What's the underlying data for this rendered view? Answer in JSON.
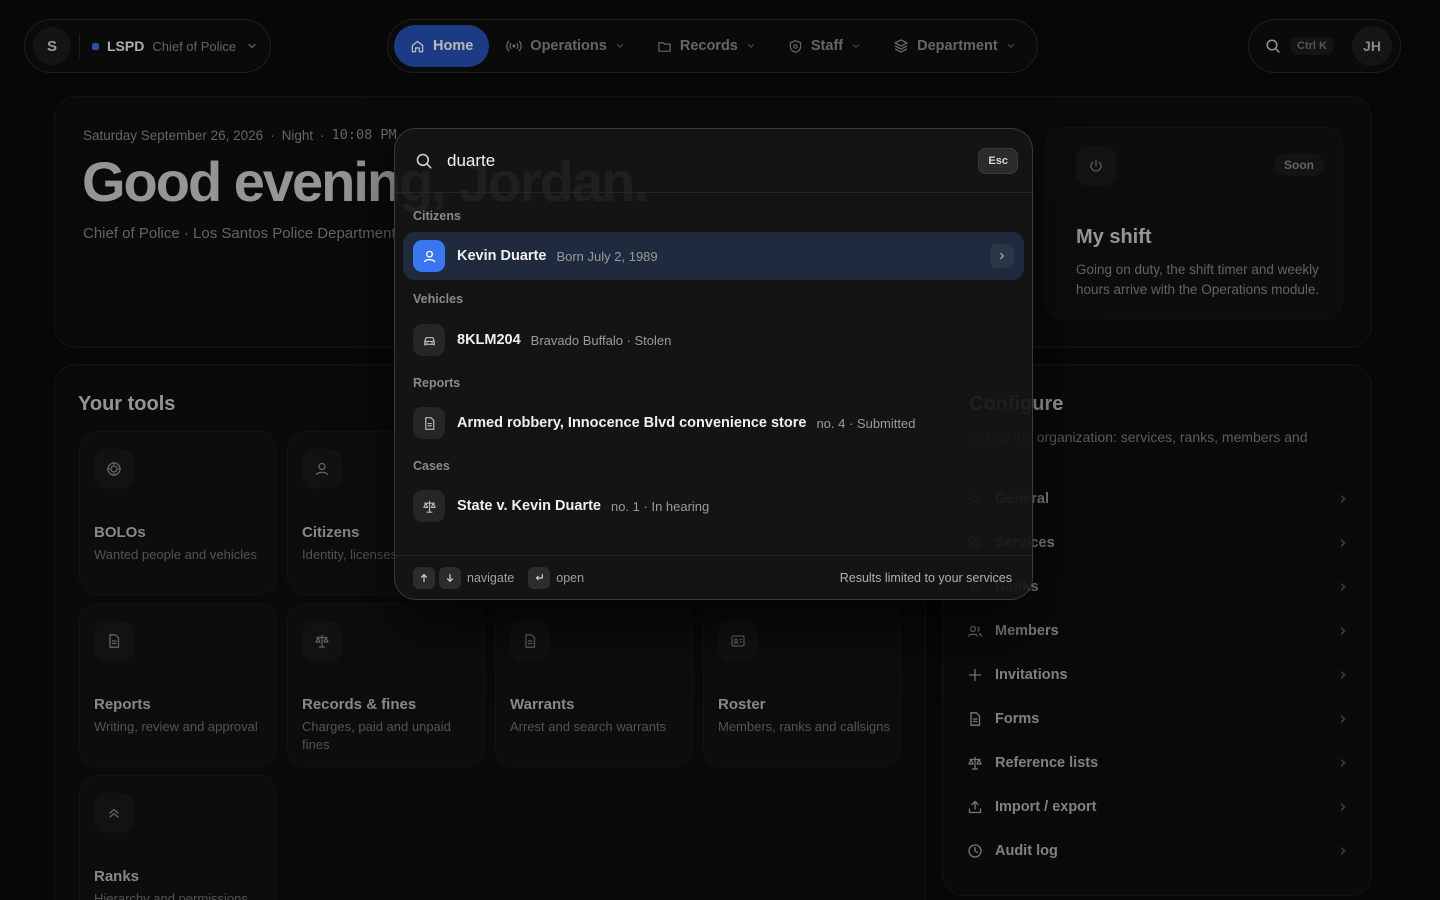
{
  "org": {
    "avatar_letter": "S",
    "name": "LSPD",
    "role": "Chief of Police",
    "accent": "#3b6fe0"
  },
  "nav": {
    "items": [
      {
        "label": "Home",
        "icon": "home-icon",
        "active": true
      },
      {
        "label": "Operations",
        "icon": "radio-icon"
      },
      {
        "label": "Records",
        "icon": "folder-icon"
      },
      {
        "label": "Staff",
        "icon": "badge-icon"
      },
      {
        "label": "Department",
        "icon": "layers-icon"
      }
    ],
    "active_color": "#2753b8"
  },
  "topright": {
    "shortcut": "Ctrl K",
    "user_initials": "JH"
  },
  "hero": {
    "date": "Saturday September 26, 2026",
    "period": "Night",
    "time": "10:08 PM",
    "greeting": "Good evening, Jordan.",
    "subtitle": "Chief of Police · Los Santos Police Department"
  },
  "shift": {
    "badge": "Soon",
    "title": "My shift",
    "description": "Going on duty, the shift timer and weekly hours arrive with the Operations module."
  },
  "tools": {
    "title": "Your tools",
    "items": [
      {
        "title": "BOLOs",
        "desc": "Wanted people and vehicles",
        "icon": "target-icon"
      },
      {
        "title": "Citizens",
        "desc": "Identity, licenses",
        "icon": "user-icon"
      },
      {
        "title": "Reports",
        "desc": "Writing, review and approval",
        "icon": "document-icon"
      },
      {
        "title": "Records & fines",
        "desc": "Charges, paid and unpaid fines",
        "icon": "scales-icon"
      },
      {
        "title": "Warrants",
        "desc": "Arrest and search warrants",
        "icon": "document-icon"
      },
      {
        "title": "Roster",
        "desc": "Members, ranks and callsigns",
        "icon": "id-card-icon"
      },
      {
        "title": "Ranks",
        "desc": "Hierarchy and permissions",
        "icon": "chevrons-up-icon"
      }
    ]
  },
  "config": {
    "title": "Configure",
    "description": "Set up the organization: services, ranks, members and",
    "items": [
      {
        "label": "General",
        "icon": "gear-icon"
      },
      {
        "label": "Services",
        "icon": "grid-icon"
      },
      {
        "label": "Ranks",
        "icon": "chevrons-up-icon"
      },
      {
        "label": "Members",
        "icon": "users-icon"
      },
      {
        "label": "Invitations",
        "icon": "plus-icon"
      },
      {
        "label": "Forms",
        "icon": "document-icon"
      },
      {
        "label": "Reference lists",
        "icon": "scales-icon"
      },
      {
        "label": "Import / export",
        "icon": "upload-icon"
      },
      {
        "label": "Audit log",
        "icon": "clock-icon"
      }
    ]
  },
  "palette": {
    "query": "duarte",
    "esc_label": "Esc",
    "groups": [
      {
        "label": "Citizens",
        "rows": [
          {
            "title": "Kevin Duarte",
            "meta": "Born July 2, 1989",
            "icon": "user-icon",
            "selected": true
          }
        ]
      },
      {
        "label": "Vehicles",
        "rows": [
          {
            "title": "8KLM204",
            "meta": "Bravado Buffalo · Stolen",
            "icon": "car-icon"
          }
        ]
      },
      {
        "label": "Reports",
        "rows": [
          {
            "title": "Armed robbery, Innocence Blvd convenience store",
            "meta": "no. 4 · Submitted",
            "icon": "document-icon"
          }
        ]
      },
      {
        "label": "Cases",
        "rows": [
          {
            "title": "State v. Kevin Duarte",
            "meta": "no. 1 · In hearing",
            "icon": "scales-icon"
          }
        ]
      }
    ],
    "footer": {
      "navigate": "navigate",
      "open": "open",
      "limit": "Results limited to your services"
    },
    "selection_color": "#3a76f0"
  }
}
